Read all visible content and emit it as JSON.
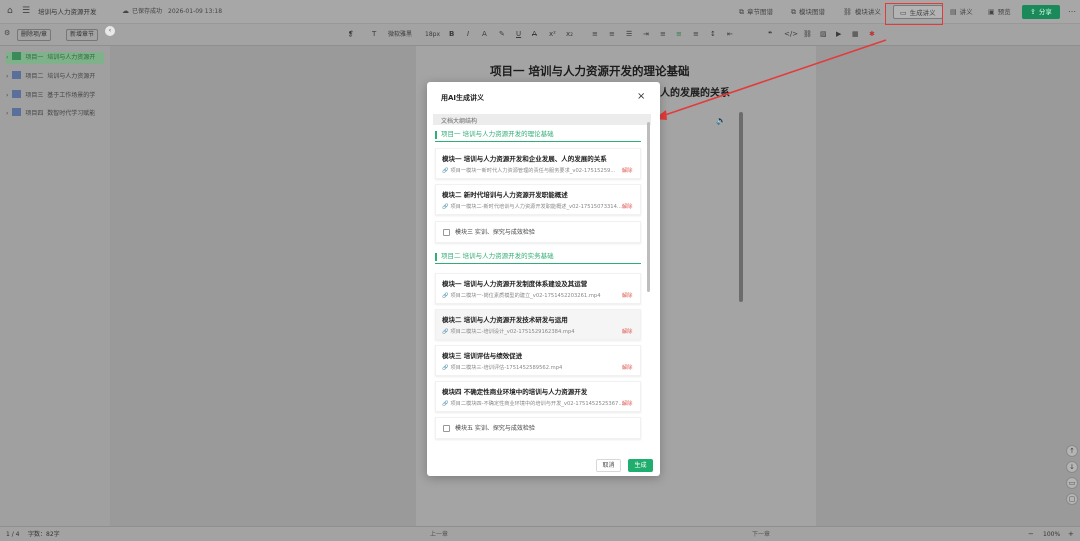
{
  "topbar": {
    "breadcrumb": "培训与人力资源开发",
    "save_status": "已保存成功",
    "save_time": "2026-01-09 13:18",
    "buttons": [
      "章节图谱",
      "模块图谱",
      "模块讲义",
      "生成讲义",
      "讲义",
      "预览"
    ],
    "share": "分享"
  },
  "toolbar": {
    "delete_btn": "删除项/章",
    "add_btn": "新增章节",
    "font": "微软雅黑",
    "size": "18px"
  },
  "sidebar": {
    "items": [
      {
        "num": "项目一",
        "label": "培训与人力资源开"
      },
      {
        "num": "项目二",
        "label": "培训与人力资源开"
      },
      {
        "num": "项目三",
        "label": "基于工作场景的学"
      },
      {
        "num": "项目四",
        "label": "数智时代学习赋能"
      }
    ]
  },
  "doc": {
    "title": "项目一    培训与人力资源开发的理论基础",
    "subtitle": "人的发展的关系"
  },
  "modal": {
    "title": "用AI生成讲义",
    "outline_head": "文档大纲结构",
    "projects": [
      {
        "title": "项目一    培训与人力资源开发的理论基础",
        "modules": [
          {
            "title": "模块一    培训与人力资源开发和企业发展、人的发展的关系",
            "file": "项目一模块一新时代人力资源管理的责任与服务要求_v02-17515259...",
            "action": "解除"
          },
          {
            "title": "模块二    新时代培训与人力资源开发职能概述",
            "file": "项目一模块二-新时代培训与人力资源开发职能概述_v02-17515073314...",
            "action": "解除"
          }
        ],
        "checkbox": "模块三    实训、探究与成效检验"
      },
      {
        "title": "项目二    培训与人力资源开发的实务基础",
        "modules": [
          {
            "title": "模块一    培训与人力资源开发制度体系建设及其运营",
            "file": "项目二模块一-岗位素质模型的建立_v02-1751452203261.mp4",
            "action": "解除"
          },
          {
            "title": "模块二    培训与人力资源开发技术研发与运用",
            "file": "项目二模块二-培训设计_v02-1751529162384.mp4",
            "action": "解除"
          },
          {
            "title": "模块三    培训评估与绩效促进",
            "file": "项目二模块三-培训评估-1751452589562.mp4",
            "action": "解除"
          },
          {
            "title": "模块四    不确定性商业环境中的培训与人力资源开发",
            "file": "项目二模块四-不确定性商业环境中的培训与开发_v02-1751452525367...",
            "action": "解除"
          }
        ],
        "checkbox": "模块五    实训、探究与成效检验"
      }
    ],
    "cancel": "取消",
    "create": "生成"
  },
  "bottombar": {
    "page": "1 / 4",
    "words": "字数：82字",
    "prev": "上一章",
    "next": "下一章",
    "zoom": "100%"
  },
  "colors": {
    "accent_green": "#1fae6e",
    "annotation_red": "#e23b3b",
    "delete_red": "#e0554d"
  }
}
